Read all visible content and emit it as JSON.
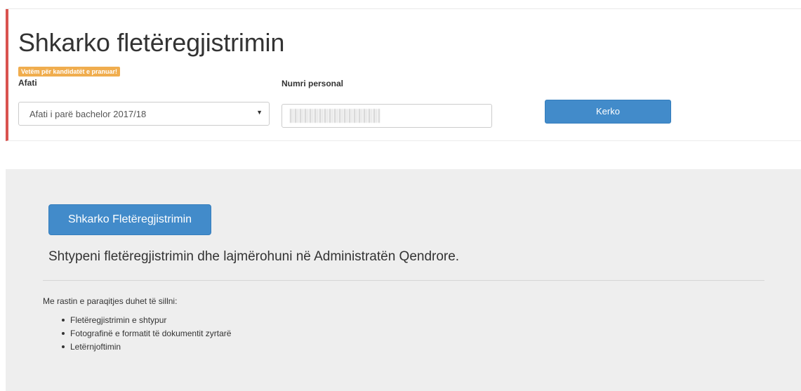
{
  "header": {
    "title": "Shkarko fletëregjistrimin",
    "badge": "Vetëm për kandidatët e pranuar!"
  },
  "form": {
    "term_label": "Afati",
    "term_value": "Afati i parë bachelor 2017/18",
    "personal_number_label": "Numri personal",
    "search_label": "Kerko"
  },
  "result": {
    "download_label": "Shkarko Fletëregjistrimin",
    "instruction": "Shtypeni fletëregjistrimin dhe lajmërohuni në Administratën Qendrore.",
    "requirements_intro": "Me rastin e paraqitjes duhet të sillni:",
    "requirements": [
      "Fletëregjistrimin e shtypur",
      "Fotografinë e formatit të dokumentit zyrtarë",
      "Letërnjoftimin"
    ]
  },
  "colors": {
    "accent_border": "#d9534f",
    "primary_button": "#428bca",
    "warning_badge": "#f0ad4e",
    "panel_background": "#eeeeee"
  }
}
